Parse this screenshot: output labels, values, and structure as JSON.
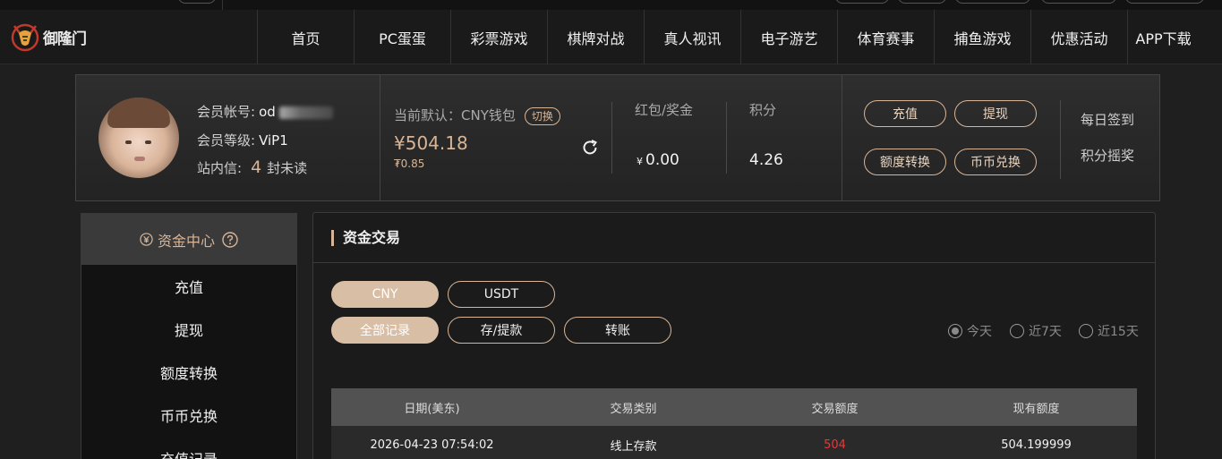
{
  "logo": {
    "text": "御隆门"
  },
  "nav": [
    "首页",
    "PC蛋蛋",
    "彩票游戏",
    "棋牌对战",
    "真人视讯",
    "电子游艺",
    "体育赛事",
    "捕鱼游戏",
    "优惠活动",
    "APP下载"
  ],
  "profile": {
    "account_label": "会员帐号:",
    "account_value": "od",
    "level_label": "会员等级:",
    "level_value": "ViP1",
    "inbox_label": "站内信:",
    "inbox_count": "4",
    "inbox_unit": "封未读"
  },
  "wallet": {
    "default_label": "当前默认：CNY钱包",
    "switch_label": "切换",
    "amount": "¥504.18",
    "sub_amount": "₮0.85",
    "bonus_label": "红包/奖金",
    "bonus_currency": "¥",
    "bonus_value": "0.00",
    "points_label": "积分",
    "points_value": "4.26"
  },
  "actions": {
    "deposit": "充值",
    "withdraw": "提现",
    "transfer": "额度转换",
    "exchange": "币币兑换",
    "checkin": "每日签到",
    "lottery": "积分摇奖"
  },
  "sidebar": {
    "title": "资金中心",
    "items": [
      "充值",
      "提现",
      "额度转换",
      "币币兑换",
      "充值记录"
    ]
  },
  "main": {
    "title": "资金交易",
    "currency_tabs": [
      "CNY",
      "USDT"
    ],
    "record_tabs": [
      "全部记录",
      "存/提款",
      "转账"
    ],
    "ranges": [
      "今天",
      "近7天",
      "近15天"
    ],
    "selected_range": "今天",
    "table": {
      "headers": [
        "日期(美东)",
        "交易类别",
        "交易额度",
        "现有额度"
      ],
      "rows": [
        [
          "2026-04-23 07:54:02",
          "线上存款",
          "504",
          "504.199999"
        ]
      ]
    }
  },
  "colors": {
    "accent": "#d8b596",
    "negative": "#e23b3b"
  }
}
